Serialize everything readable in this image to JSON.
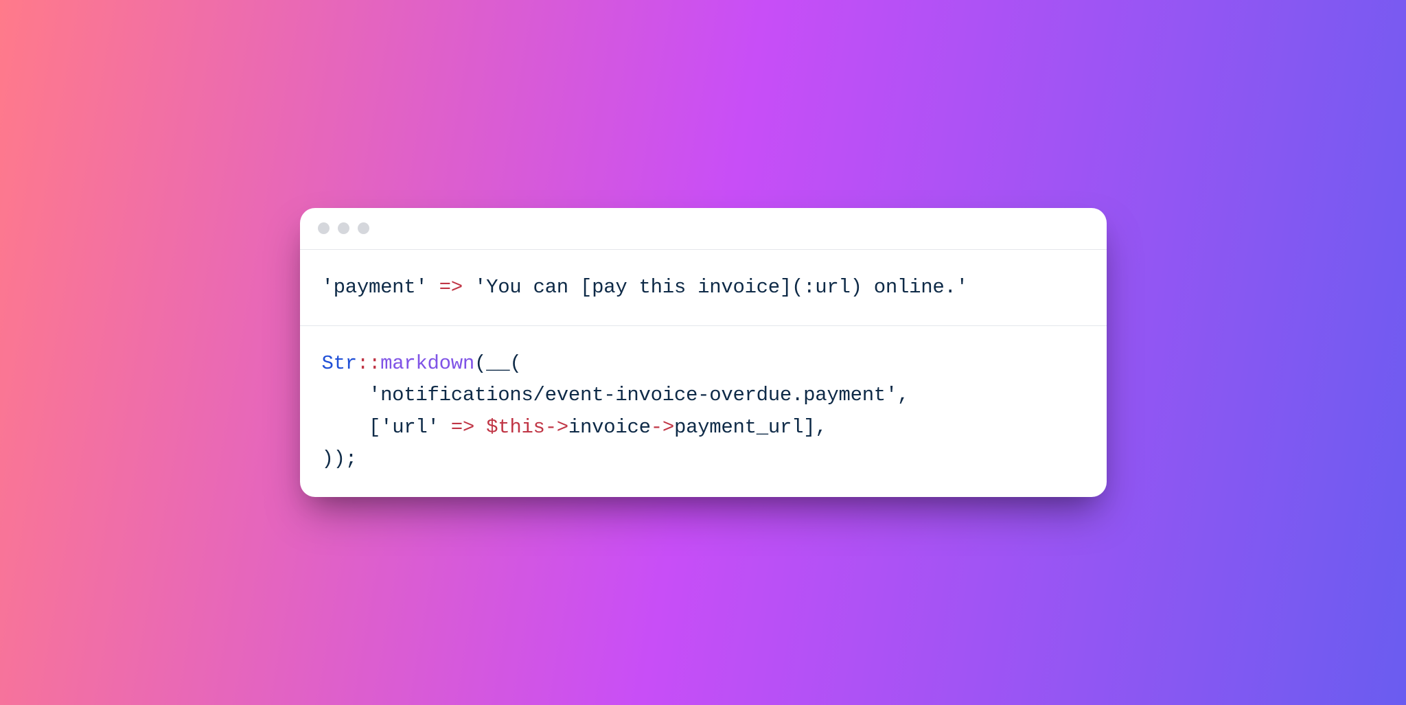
{
  "colors": {
    "gradient": [
      "#ff7a8a",
      "#c84ef7",
      "#6a5cf0"
    ],
    "card_bg": "#ffffff",
    "hairline": "#e4e6eb",
    "dot": "#d5d7dc",
    "ink_navy": "#0e2a47",
    "ink_red": "#c03545",
    "ink_blue": "#1f4fd6",
    "ink_purple": "#7f53e6"
  },
  "top_line": {
    "key": "'payment'",
    "arrow": " => ",
    "value": "'You can [pay this invoice](:url) online.'"
  },
  "code": {
    "l1": {
      "cls": "Str",
      "sep": "::",
      "fn": "markdown",
      "open": "(__("
    },
    "l2": {
      "indent": "    ",
      "arg": "'notifications/event-invoice-overdue.payment'",
      "comma": ","
    },
    "l3": {
      "indent": "    ",
      "open": "[",
      "key": "'url'",
      "arrow": " => ",
      "var": "$this",
      "obj_arrow1": "->",
      "prop1": "invoice",
      "obj_arrow2": "->",
      "prop2": "payment_url",
      "close": "],"
    },
    "l4": {
      "close": "));"
    }
  }
}
